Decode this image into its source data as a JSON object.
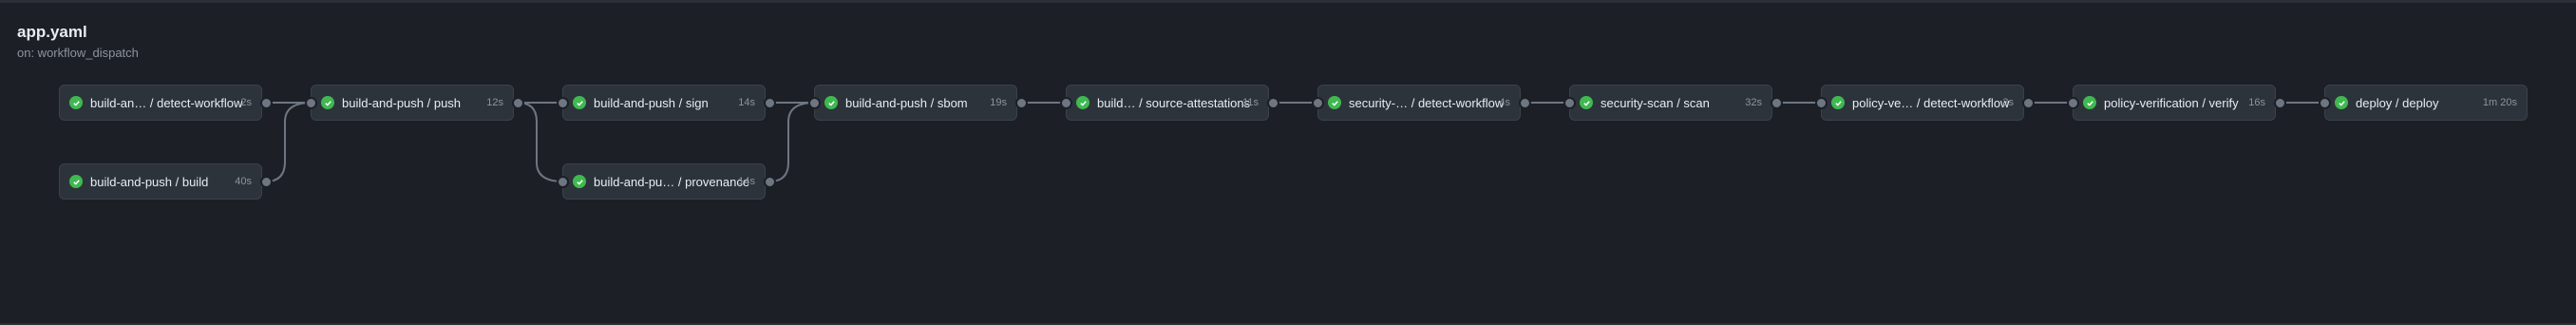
{
  "workflow": {
    "title": "app.yaml",
    "trigger": "on: workflow_dispatch"
  },
  "jobs": [
    {
      "name": "build-an…  / detect-workflow",
      "status": "success",
      "duration": "2s"
    },
    {
      "name": "build-and-push / build",
      "status": "success",
      "duration": "40s"
    },
    {
      "name": "build-and-push / push",
      "status": "success",
      "duration": "12s"
    },
    {
      "name": "build-and-push / sign",
      "status": "success",
      "duration": "14s"
    },
    {
      "name": "build-and-pu… / provenance",
      "status": "success",
      "duration": "14s"
    },
    {
      "name": "build-and-push / sbom",
      "status": "success",
      "duration": "19s"
    },
    {
      "name": "build… / source-attestations",
      "status": "success",
      "duration": "11s"
    },
    {
      "name": "security-… / detect-workflow",
      "status": "success",
      "duration": "4s"
    },
    {
      "name": "security-scan / scan",
      "status": "success",
      "duration": "32s"
    },
    {
      "name": "policy-ve… / detect-workflow",
      "status": "success",
      "duration": "3s"
    },
    {
      "name": "policy-verification / verify",
      "status": "success",
      "duration": "16s"
    },
    {
      "name": "deploy / deploy",
      "status": "success",
      "duration": "1m 20s"
    }
  ],
  "colors": {
    "success": "#3fb950",
    "background": "#1c1f26",
    "card": "#2d333b"
  },
  "icons": {
    "status": "check-circle-icon"
  }
}
